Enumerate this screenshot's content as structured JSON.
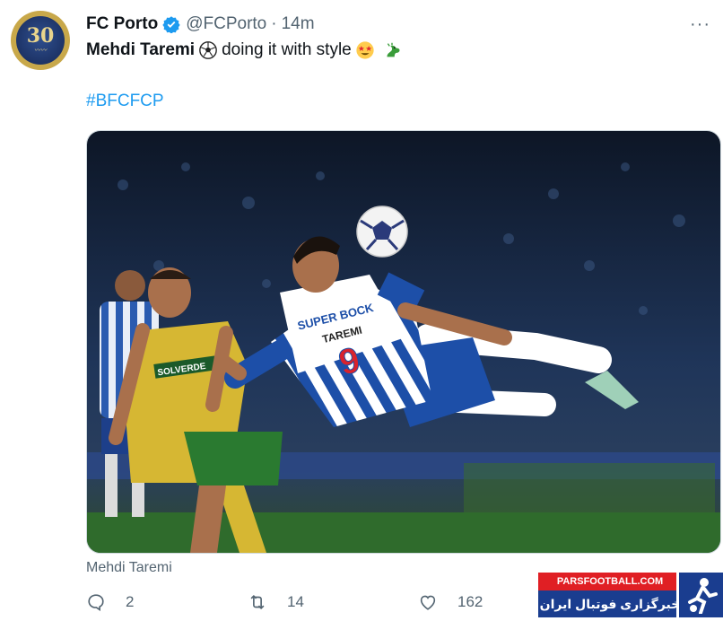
{
  "tweet": {
    "author_name": "FC Porto",
    "handle": "@FCPorto",
    "separator": "·",
    "time": "14m",
    "text_bold": "Mehdi Taremi",
    "text_rest": "doing it with style",
    "hashtag": "#BFCFCP",
    "avatar_text": "30",
    "image_caption": "Mehdi Taremi",
    "jersey_sponsor": "SUPER BOCK",
    "jersey_name": "TAREMI",
    "jersey_number": "9",
    "opponent_sponsor": "SOLVERDE"
  },
  "actions": {
    "replies": "2",
    "retweets": "14",
    "likes": "162"
  },
  "watermark": {
    "site": "PARSFOOTBALL.COM",
    "tagline": "خبرگزاری فوتبال ایران"
  },
  "icons": {
    "verified": "verified-badge-icon",
    "more": "more-icon",
    "reply": "reply-icon",
    "retweet": "retweet-icon",
    "like": "heart-icon"
  },
  "colors": {
    "accent": "#1d9bf0",
    "muted": "#536471"
  }
}
